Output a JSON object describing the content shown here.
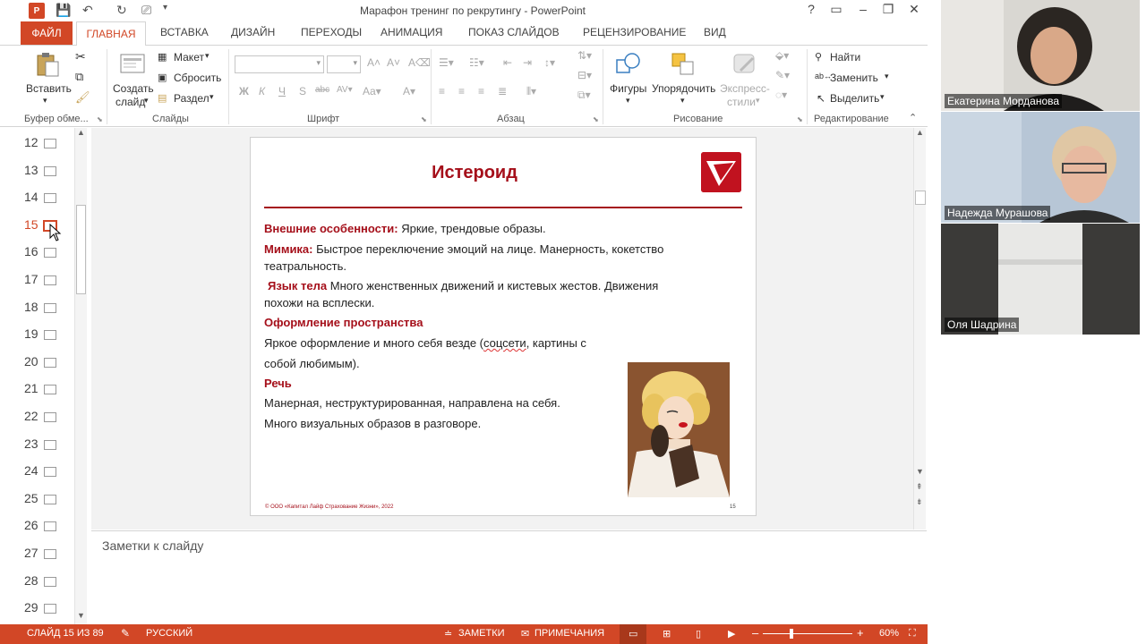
{
  "window": {
    "title": "Марафон тренинг по рекрутингу - PowerPoint",
    "app_icon": "P",
    "buttons": [
      "?",
      "▭",
      "–",
      "❐",
      "✕"
    ]
  },
  "tabs": {
    "file": "ФАЙЛ",
    "active": "ГЛАВНАЯ",
    "items": [
      "ВСТАВКА",
      "ДИЗАЙН",
      "ПЕРЕХОДЫ",
      "АНИМАЦИЯ",
      "ПОКАЗ СЛАЙДОВ",
      "РЕЦЕНЗИРОВАНИЕ",
      "ВИД"
    ]
  },
  "ribbon": {
    "clipboard": {
      "paste": "Вставить",
      "label": "Буфер обме..."
    },
    "slides": {
      "new_slide_1": "Создать",
      "new_slide_2": "слайд",
      "layout": "Макет",
      "reset": "Сбросить",
      "section": "Раздел",
      "label": "Слайды"
    },
    "font": {
      "bold": "Ж",
      "italic": "К",
      "underline": "Ч",
      "strike": "S",
      "label": "Шрифт"
    },
    "paragraph": {
      "label": "Абзац"
    },
    "drawing": {
      "shapes": "Фигуры",
      "arrange": "Упорядочить",
      "quick_1": "Экспресс-",
      "quick_2": "стили",
      "label": "Рисование"
    },
    "editing": {
      "find": "Найти",
      "replace": "Заменить",
      "select": "Выделить",
      "label": "Редактирование"
    }
  },
  "thumbnails": {
    "numbers": [
      "12",
      "13",
      "14",
      "15",
      "16",
      "17",
      "18",
      "19",
      "20",
      "21",
      "22",
      "23",
      "24",
      "25",
      "26",
      "27",
      "28",
      "29"
    ],
    "active": "15"
  },
  "slide": {
    "title": "Истероид",
    "line1_label": "Внешние особенности:",
    "line1_text": " Яркие, трендовые образы.",
    "line2_label": "Мимика:",
    "line2_text": " Быстрое переключение эмоций на лице. Манерность, кокетство",
    "line2_cont": "театральность.",
    "line3_label": "Язык тела",
    "line3_text": " Много женственных движений и кистевых жестов. Движения",
    "line3_cont": "похожи на всплески.",
    "section4": "Оформление пространства",
    "line4a": "Яркое оформление и много себя везде (",
    "line4_squiggle": "соцсети",
    "line4b": ", картины с",
    "line4_cont": "собой любимым).",
    "section5": "Речь",
    "line5a": "Манерная, неструктурированная, направлена на себя.",
    "line5b": "Много визуальных образов в разговоре.",
    "footer": "© ООО «Капитал Лайф Страхование Жизни», 2022",
    "page_number": "15"
  },
  "notes": {
    "placeholder": "Заметки к слайду"
  },
  "status": {
    "slide_info": "СЛАЙД 15 ИЗ 89",
    "language": "РУССКИЙ",
    "notes": "ЗАМЕТКИ",
    "comments": "ПРИМЕЧАНИЯ",
    "zoom": "60%"
  },
  "participants": [
    {
      "name": "Екатерина Морданова"
    },
    {
      "name": "Надежда Мурашова"
    },
    {
      "name": "Оля Шадрина"
    }
  ],
  "colors": {
    "accent": "#d24726",
    "slide_red": "#a50f1a"
  }
}
